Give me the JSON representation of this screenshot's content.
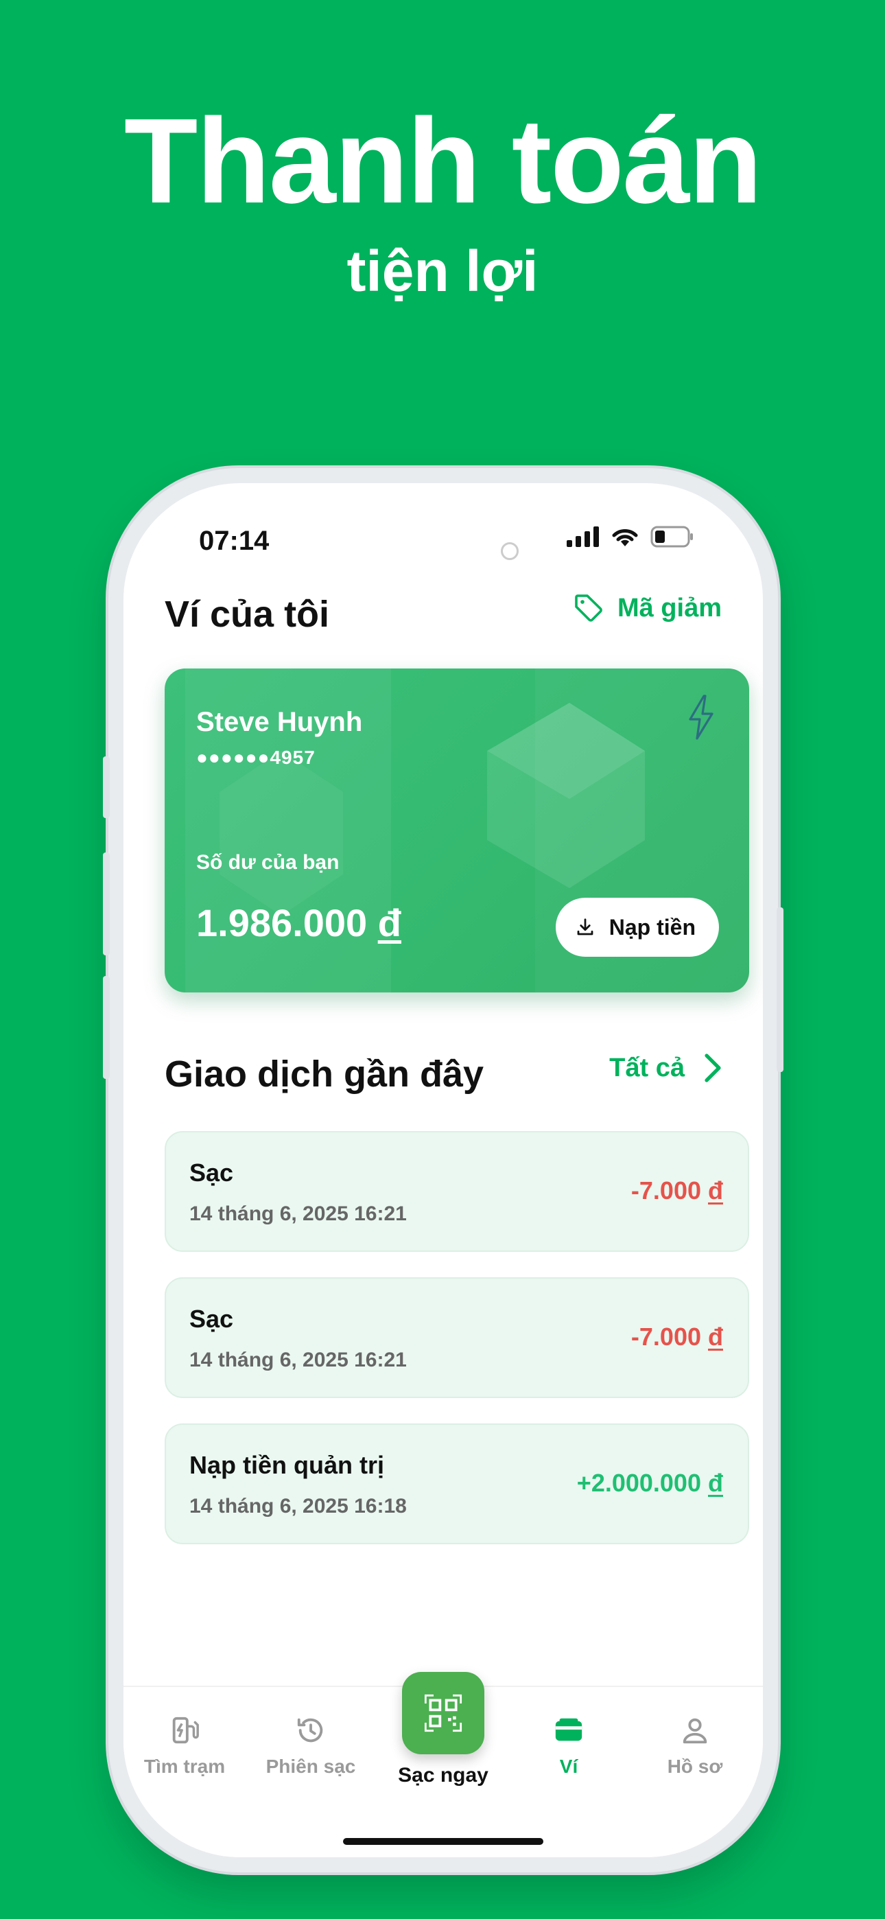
{
  "hero": {
    "title": "Thanh toán",
    "subtitle": "tiện lợi"
  },
  "status_bar": {
    "time": "07:14",
    "icons": [
      "signal-icon",
      "wifi-icon",
      "battery-icon"
    ]
  },
  "header": {
    "title": "Ví của tôi",
    "promo_label": "Mã giảm",
    "promo_icon": "tag-icon"
  },
  "card": {
    "name": "Steve Huynh",
    "masked_number": "●●●●●●4957",
    "balance_label": "Số dư của bạn",
    "balance_value": "1.986.000",
    "currency": "đ",
    "topup_label": "Nạp tiền",
    "logo_icon": "lightning-icon"
  },
  "transactions": {
    "title": "Giao dịch gần đây",
    "see_all_label": "Tất cả",
    "items": [
      {
        "title": "Sạc",
        "date": "14 tháng 6, 2025 16:21",
        "amount": "-7.000",
        "currency": "đ",
        "type": "debit"
      },
      {
        "title": "Sạc",
        "date": "14 tháng 6, 2025 16:21",
        "amount": "-7.000",
        "currency": "đ",
        "type": "debit"
      },
      {
        "title": "Nạp tiền quản trị",
        "date": "14 tháng 6, 2025 16:18",
        "amount": "+2.000.000",
        "currency": "đ",
        "type": "credit"
      }
    ]
  },
  "nav": {
    "items": [
      {
        "label": "Tìm trạm",
        "icon": "ev-station-icon"
      },
      {
        "label": "Phiên sạc",
        "icon": "history-icon"
      },
      {
        "label": "Sạc ngay",
        "icon": "qr-scan-icon"
      },
      {
        "label": "Ví",
        "icon": "wallet-icon",
        "active": true
      },
      {
        "label": "Hồ sơ",
        "icon": "user-icon"
      }
    ]
  },
  "colors": {
    "brand": "#00B25C",
    "debit": "#E5534B",
    "credit": "#1FBF72"
  }
}
